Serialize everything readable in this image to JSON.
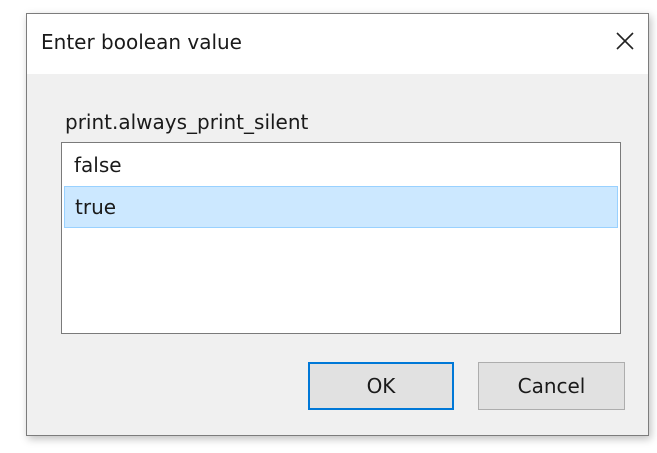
{
  "window": {
    "title": "Enter boolean value",
    "close_icon": "close-icon"
  },
  "prompt": {
    "label": "print.always_print_silent"
  },
  "listbox": {
    "options": [
      "false",
      "true"
    ],
    "selected": "true",
    "selected_index": 1
  },
  "buttons": {
    "ok_label": "OK",
    "cancel_label": "Cancel"
  },
  "colors": {
    "selection_background": "#cce8ff",
    "selection_border": "#99d1ff",
    "default_button_border": "#0078d7",
    "dialog_background": "#f0f0f0"
  }
}
